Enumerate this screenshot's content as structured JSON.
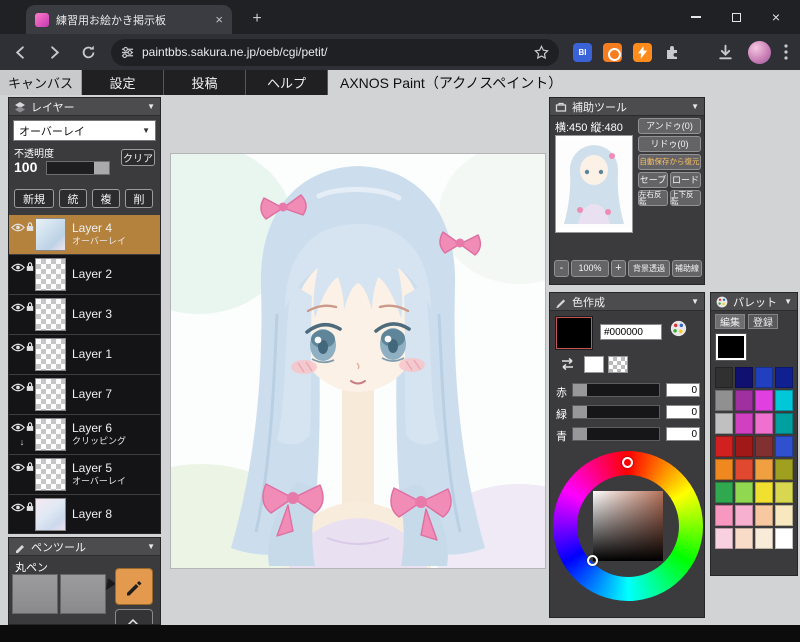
{
  "browser": {
    "tab_title": "練習用お絵かき掲示板",
    "url": "paintbbs.sakura.ne.jp/oeb/cgi/petit/",
    "extension_badge": "BI"
  },
  "app": {
    "tabs": [
      "キャンバス",
      "設定",
      "投稿",
      "ヘルプ"
    ],
    "title": "AXNOS Paint（アクノスペイント）"
  },
  "layers_panel": {
    "title": "レイヤー",
    "blend_mode": "オーバーレイ",
    "opacity_label": "不透明度",
    "opacity_value": "100",
    "clear_button": "クリア",
    "buttons": [
      "新規",
      "統",
      "複",
      "削"
    ],
    "layers": [
      {
        "name": "Layer 4",
        "sub": "オーバーレイ",
        "selected": true,
        "thumb": "art-blue"
      },
      {
        "name": "Layer 2",
        "sub": "",
        "thumb": "checker"
      },
      {
        "name": "Layer 3",
        "sub": "",
        "thumb": "checker"
      },
      {
        "name": "Layer 1",
        "sub": "",
        "thumb": "checker"
      },
      {
        "name": "Layer 7",
        "sub": "",
        "thumb": "checker"
      },
      {
        "name": "Layer 6",
        "sub": "クリッピング",
        "thumb": "checker",
        "clip": true
      },
      {
        "name": "Layer 5",
        "sub": "オーバーレイ",
        "thumb": "checker"
      },
      {
        "name": "Layer 8",
        "sub": "",
        "thumb": "art-pink"
      }
    ]
  },
  "pen_panel": {
    "title": "ペンツール",
    "pen_name": "丸ペン"
  },
  "aux_panel": {
    "title": "補助ツール",
    "canvas_size": "横:450 縦:480",
    "undo": "アンドゥ(0)",
    "redo": "リドゥ(0)",
    "restore": "自動保存から復元",
    "save": "セーブ",
    "load": "ロード",
    "flip_h": "左右反転",
    "flip_v": "上下反転",
    "zoom_out": "-",
    "zoom_level": "100%",
    "zoom_in": "+",
    "bg_transparent": "背景透過",
    "guide_line": "補助線"
  },
  "color_panel": {
    "title": "色作成",
    "hex": "#000000",
    "channels": [
      {
        "label": "赤",
        "value": "0"
      },
      {
        "label": "緑",
        "value": "0"
      },
      {
        "label": "青",
        "value": "0"
      }
    ]
  },
  "palette_panel": {
    "title": "パレット",
    "tabs": [
      "編集",
      "登録"
    ],
    "current_color": "#000000",
    "colors": [
      "#303030",
      "#101070",
      "#2040c0",
      "#102090",
      "#909090",
      "#a030a0",
      "#e040e0",
      "#00c8d8",
      "#c0c0c0",
      "#d040c0",
      "#f070d0",
      "#00a0a0",
      "#d02020",
      "#a01818",
      "#803030",
      "#3050d0",
      "#f08820",
      "#e04830",
      "#f0a040",
      "#a0a020",
      "#30a850",
      "#90d850",
      "#f0e030",
      "#d8d850",
      "#f898c0",
      "#f8b0d0",
      "#f8c8a0",
      "#f8e8c0",
      "#f8d0e0",
      "#f8dcc8",
      "#f8ecd8",
      "#ffffff"
    ]
  },
  "ui_colors": {
    "selected_layer": "#b5823e",
    "active_tool": "#e39a4f",
    "restore_text": "#ffc163"
  }
}
